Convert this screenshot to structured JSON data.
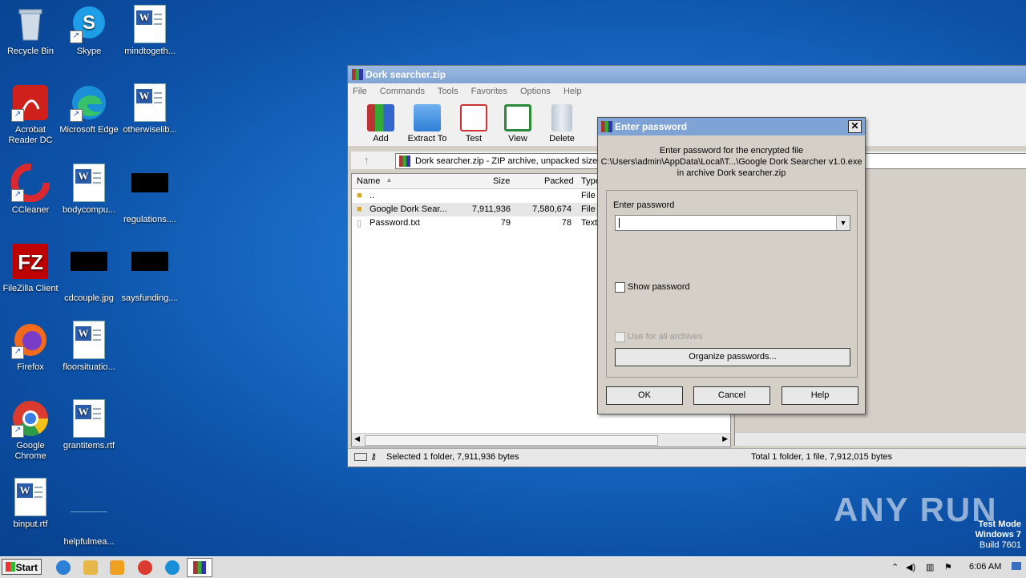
{
  "desktop": {
    "icons": [
      {
        "label": "Recycle Bin"
      },
      {
        "label": "Skype"
      },
      {
        "label": "mindtogeth..."
      },
      {
        "label": "Acrobat Reader DC"
      },
      {
        "label": "Microsoft Edge"
      },
      {
        "label": "otherwiselib..."
      },
      {
        "label": "CCleaner"
      },
      {
        "label": "bodycompu..."
      },
      {
        "label": "regulations...."
      },
      {
        "label": "FileZilla Client"
      },
      {
        "label": "cdcouple.jpg"
      },
      {
        "label": "saysfunding...."
      },
      {
        "label": "Firefox"
      },
      {
        "label": "floorsituatio..."
      },
      {
        "label": "Google Chrome"
      },
      {
        "label": "grantitems.rtf"
      },
      {
        "label": "binput.rtf"
      },
      {
        "label": "helpfulmea..."
      }
    ]
  },
  "window": {
    "title": "Dork searcher.zip",
    "menu": [
      "File",
      "Commands",
      "Tools",
      "Favorites",
      "Options",
      "Help"
    ],
    "toolbar": [
      "Add",
      "Extract To",
      "Test",
      "View",
      "Delete"
    ],
    "address": "Dork searcher.zip - ZIP archive, unpacked size 7",
    "columns": {
      "name": "Name",
      "size": "Size",
      "packed": "Packed",
      "type": "Type"
    },
    "files": [
      {
        "name": "..",
        "size": "",
        "packed": "",
        "type": "File f"
      },
      {
        "name": "Google Dork Sear...",
        "size": "7,911,936",
        "packed": "7,580,674",
        "type": "File f"
      },
      {
        "name": "Password.txt",
        "size": "79",
        "packed": "78",
        "type": "Text"
      }
    ],
    "status_left": "Selected 1 folder, 7,911,936 bytes",
    "status_right": "Total 1 folder, 1 file, 7,912,015 bytes"
  },
  "dialog": {
    "title": "Enter password",
    "close": "✕",
    "info_line1": "Enter password for the encrypted file",
    "info_line2": "C:\\Users\\admin\\AppData\\Local\\T...\\Google Dork Searcher v1.0.exe",
    "info_line3": "in archive Dork searcher.zip",
    "field_label": "Enter password",
    "password_value": "",
    "show_password": "Show password",
    "use_all": "Use for all archives",
    "organize": "Organize passwords...",
    "ok": "OK",
    "cancel": "Cancel",
    "help": "Help"
  },
  "taskbar": {
    "start": "Start",
    "clock": "6:06 AM"
  },
  "watermark": "ANY RUN",
  "testmode": {
    "line1": "Test Mode",
    "line2": "Windows 7",
    "line3": "Build 7601"
  }
}
